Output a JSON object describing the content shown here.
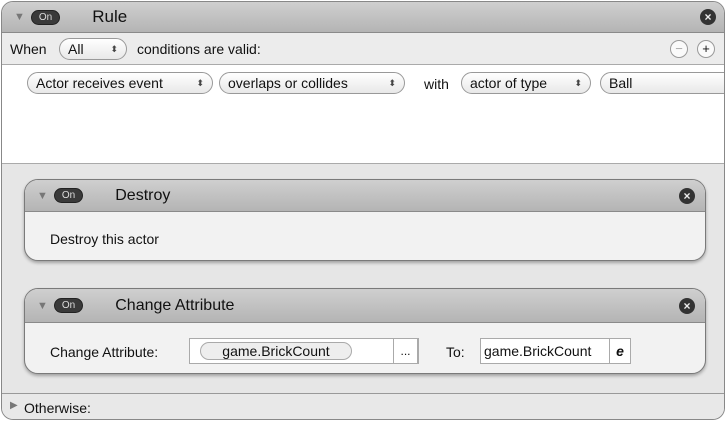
{
  "rule": {
    "toggle": "On",
    "title": "Rule",
    "when_label": "When",
    "match": "All",
    "conditions_suffix": "conditions are valid:",
    "minus": "−",
    "plus": "+"
  },
  "condition": {
    "subject": "Actor receives event",
    "event": "overlaps or collides",
    "with_label": "with",
    "target_type": "actor of type",
    "target": "Ball"
  },
  "actions": [
    {
      "toggle": "On",
      "title": "Destroy",
      "body": "Destroy this actor"
    },
    {
      "toggle": "On",
      "title": "Change Attribute",
      "attr_label": "Change Attribute:",
      "attr_value": "game.BrickCount",
      "browse": "...",
      "to_label": "To:",
      "to_value": "game.BrickCount",
      "expr_icon": "e"
    }
  ],
  "otherwise": "Otherwise:"
}
